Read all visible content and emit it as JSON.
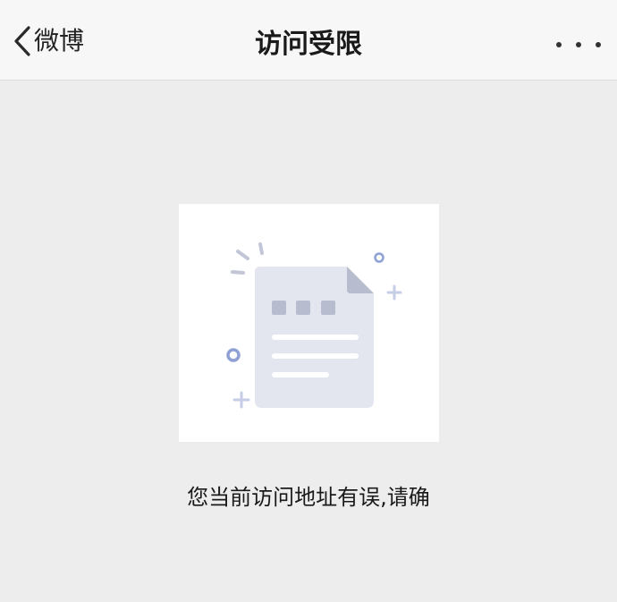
{
  "navbar": {
    "back_label": "微博",
    "title": "访问受限",
    "more_icon": "more-dots-icon",
    "back_icon": "chevron-left-icon"
  },
  "illustration": {
    "icon": "empty-document-icon"
  },
  "message": {
    "text": "您当前访问地址有误,请确"
  },
  "colors": {
    "page_background": "#ededed",
    "navbar_background": "#f7f7f7",
    "document_fill": "#e3e5ef",
    "document_blocks": "#b8bccf",
    "accent_blue": "#8fa0d6"
  }
}
